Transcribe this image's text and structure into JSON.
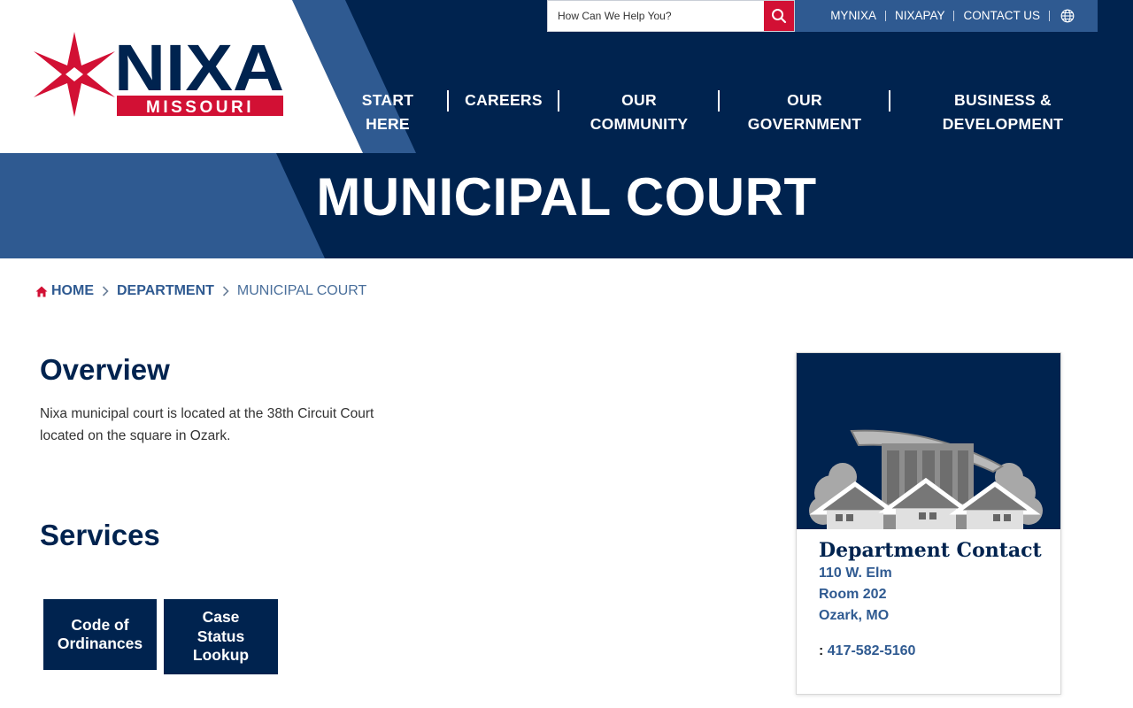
{
  "search": {
    "placeholder": "How Can We Help You?"
  },
  "utility_links": [
    "MYNIXA",
    "NIXAPAY",
    "CONTACT US"
  ],
  "logo": {
    "brand": "NIXA",
    "state": "MISSOURI"
  },
  "nav": [
    {
      "line1": "START",
      "line2": "HERE"
    },
    {
      "line1": "CAREERS",
      "line2": ""
    },
    {
      "line1": "OUR",
      "line2": "COMMUNITY"
    },
    {
      "line1": "OUR",
      "line2": "GOVERNMENT"
    },
    {
      "line1": "BUSINESS &",
      "line2": "DEVELOPMENT"
    }
  ],
  "banner": {
    "title": "MUNICIPAL COURT"
  },
  "breadcrumb": {
    "home": "HOME",
    "parent": "DEPARTMENT",
    "current": "MUNICIPAL COURT"
  },
  "overview": {
    "heading": "Overview",
    "text": "Nixa municipal court is located at the 38th Circuit Court located on the square in Ozark."
  },
  "services": {
    "heading": "Services",
    "buttons": [
      {
        "line1": "Code of",
        "line2": "Ordinances",
        "line3": ""
      },
      {
        "line1": "Case",
        "line2": "Status",
        "line3": "Lookup"
      }
    ]
  },
  "contact": {
    "title": "Department Contact",
    "address": [
      "110 W. Elm",
      "Room 202",
      "Ozark, MO"
    ],
    "phone_prefix": ":",
    "phone": "417-582-5160"
  },
  "colors": {
    "navy": "#00234f",
    "steel_blue": "#2f5a91",
    "red": "#d21034"
  }
}
